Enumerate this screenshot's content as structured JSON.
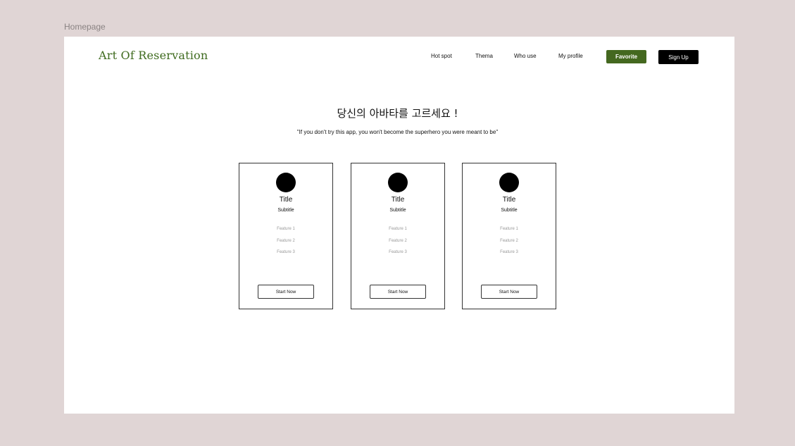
{
  "frame_label": "Homepage",
  "header": {
    "logo": "Art Of Reservation",
    "nav": [
      {
        "label": "Hot spot"
      },
      {
        "label": "Thema"
      },
      {
        "label": "Who use"
      },
      {
        "label": "My profile"
      }
    ],
    "favorite_label": "Favorite",
    "signup_label": "Sign Up"
  },
  "hero": {
    "title": "당신의 아바타를 고르세요 !",
    "quote": "\"If you don't try this app, you won't become the superhero you were meant to be\""
  },
  "cards": [
    {
      "title": "Title",
      "subtitle": "Subtitle",
      "features": [
        "Feature 1",
        "Feature 2",
        "Feature 3"
      ],
      "button": "Start Now"
    },
    {
      "title": "Title",
      "subtitle": "Subtitle",
      "features": [
        "Feature 1",
        "Feature 2",
        "Feature 3"
      ],
      "button": "Start Now"
    },
    {
      "title": "Title",
      "subtitle": "Subtitle",
      "features": [
        "Feature 1",
        "Feature 2",
        "Feature 3"
      ],
      "button": "Start Now"
    }
  ],
  "colors": {
    "brand_green": "#44681f",
    "logo_green": "#3f6b1f",
    "background": "#e0d5d5"
  }
}
